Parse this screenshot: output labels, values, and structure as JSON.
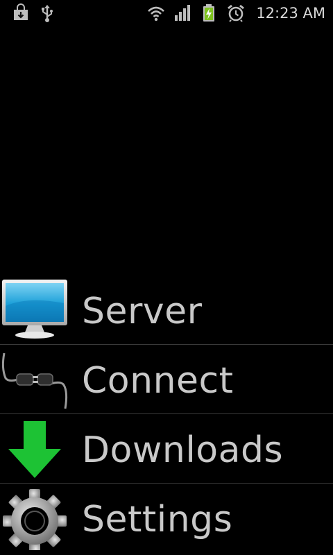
{
  "status_bar": {
    "time": "12:23 AM",
    "icons": [
      "download-notification-icon",
      "usb-icon",
      "wifi-icon",
      "signal-icon",
      "battery-charging-icon",
      "alarm-icon"
    ],
    "battery_color": "#7ec21f"
  },
  "menu": {
    "items": [
      {
        "label": "Server",
        "icon": "monitor-icon"
      },
      {
        "label": "Connect",
        "icon": "plug-icon"
      },
      {
        "label": "Downloads",
        "icon": "down-arrow-icon",
        "icon_color": "#1dc234"
      },
      {
        "label": "Settings",
        "icon": "gear-icon"
      }
    ]
  },
  "colors": {
    "background": "#000000",
    "label_text": "#c9c9c9",
    "divider": "#3a3a3a"
  }
}
